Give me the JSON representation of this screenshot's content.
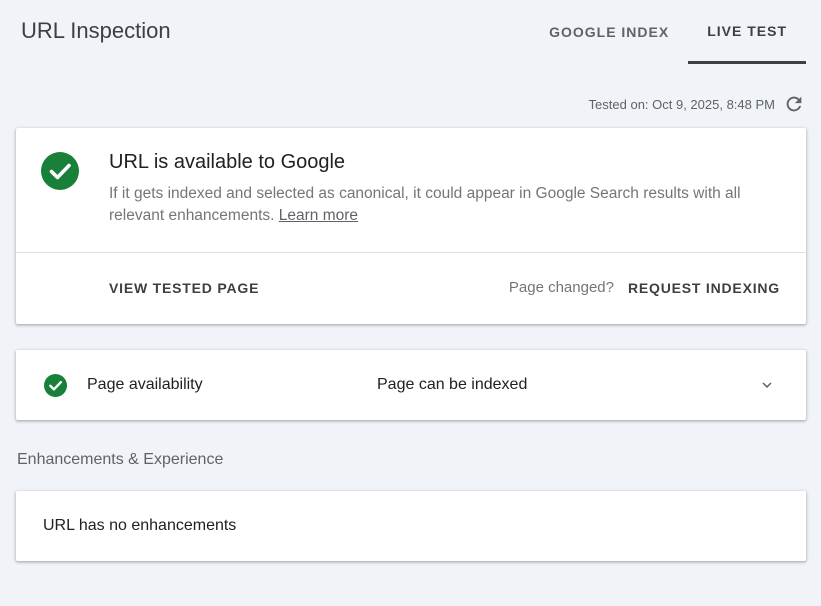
{
  "header": {
    "title": "URL Inspection",
    "tabs": [
      {
        "label": "GOOGLE INDEX",
        "active": false
      },
      {
        "label": "LIVE TEST",
        "active": true
      }
    ]
  },
  "tested": {
    "text": "Tested on: Oct 9, 2025, 8:48 PM",
    "icon": "refresh-icon"
  },
  "result_card": {
    "icon": "check-circle-icon",
    "heading": "URL is available to Google",
    "description": "If it gets indexed and selected as canonical, it could appear in Google Search results with all relevant enhancements.",
    "learn_more": "Learn more",
    "view_tested_page": "VIEW TESTED PAGE",
    "page_changed": "Page changed?",
    "request_indexing": "REQUEST INDEXING"
  },
  "availability": {
    "icon": "check-circle-icon",
    "label": "Page availability",
    "value": "Page can be indexed",
    "expand_icon": "chevron-down-icon"
  },
  "enhancements": {
    "section_label": "Enhancements & Experience",
    "text": "URL has no enhancements"
  },
  "colors": {
    "background": "#f0f4f9",
    "success_green": "#188038",
    "text_primary": "#202124",
    "text_secondary": "#5f6368"
  }
}
